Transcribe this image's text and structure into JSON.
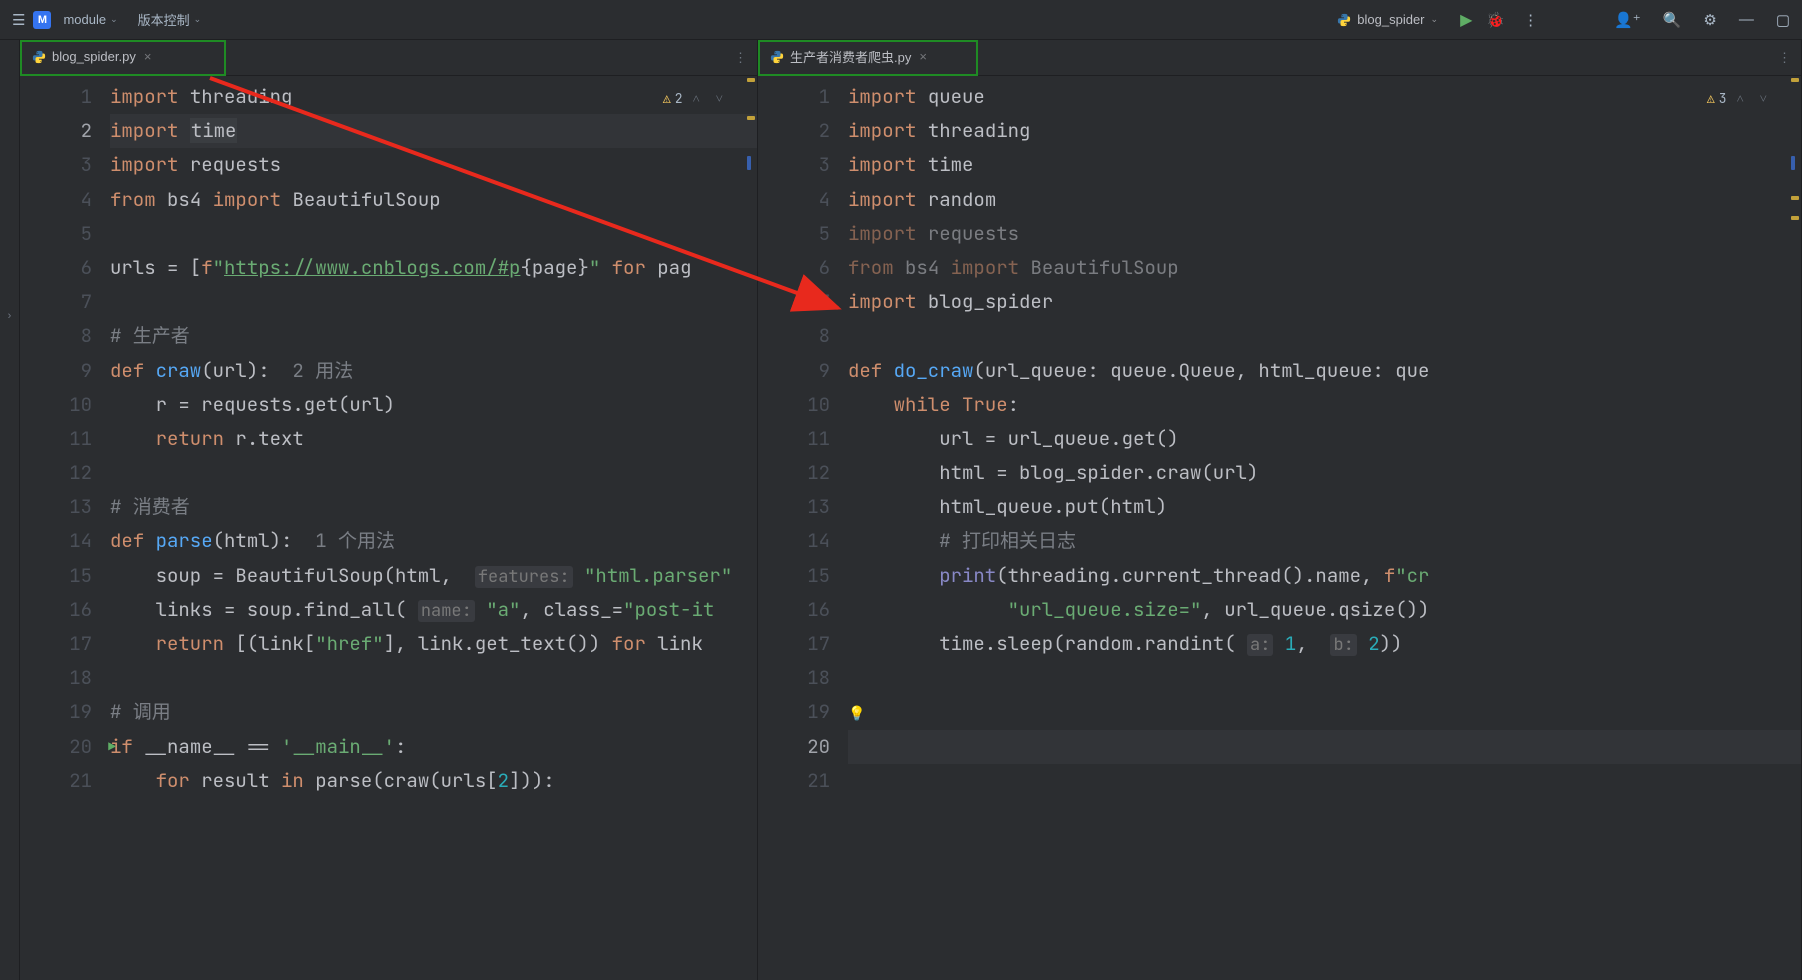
{
  "topbar": {
    "module_badge": "M",
    "module_label": "module",
    "vcs_label": "版本控制",
    "run_config": "blog_spider"
  },
  "left_editor": {
    "tab": "blog_spider.py",
    "warnings": "2",
    "lines": [
      {
        "n": "1",
        "html": "<span class='kw'>import</span> <span class='ident'>threading</span>"
      },
      {
        "n": "2",
        "html": "<span class='kw'>import</span> <span class='ident' style='background:#3a3d41;padding:0 1px'>time</span>",
        "cur": true,
        "hl": true
      },
      {
        "n": "3",
        "html": "<span class='kw'>import</span> <span class='ident'>requests</span>"
      },
      {
        "n": "4",
        "html": "<span class='kw'>from</span> <span class='ident'>bs4</span> <span class='kw'>import</span> <span class='ident'>BeautifulSoup</span>"
      },
      {
        "n": "5",
        "html": ""
      },
      {
        "n": "6",
        "html": "<span class='ident'>urls</span> = [<span class='kw'>f</span><span class='str'>\"<u>https://www.cnblogs.com/#p</u></span>{page}<span class='str'>\"</span> <span class='kw'>for</span> <span class='ident'>pag</span>"
      },
      {
        "n": "7",
        "html": ""
      },
      {
        "n": "8",
        "html": "<span class='cmt'># 生产者</span>"
      },
      {
        "n": "9",
        "html": "<span class='kw'>def</span> <span class='fn'>craw</span>(url):  <span class='cmt'>2 用法</span>"
      },
      {
        "n": "10",
        "html": "    r = requests.get(url)"
      },
      {
        "n": "11",
        "html": "    <span class='kw'>return</span> r.text"
      },
      {
        "n": "12",
        "html": ""
      },
      {
        "n": "13",
        "html": "<span class='cmt'># 消费者</span>"
      },
      {
        "n": "14",
        "html": "<span class='kw'>def</span> <span class='fn'>parse</span>(html):  <span class='cmt'>1 个用法</span>"
      },
      {
        "n": "15",
        "html": "    soup = BeautifulSoup(html,  <span class='hint'>features:</span> <span class='str'>\"html.parser\"</span>"
      },
      {
        "n": "16",
        "html": "    links = soup.find_all( <span class='hint'>name:</span> <span class='str'>\"a\"</span>, <span class='param'>class_</span>=<span class='str'>\"post-it</span>"
      },
      {
        "n": "17",
        "html": "    <span class='kw'>return</span> [(link[<span class='str'>\"href\"</span>], link.get_text()) <span class='kw'>for</span> link"
      },
      {
        "n": "18",
        "html": ""
      },
      {
        "n": "19",
        "html": "<span class='cmt'># 调用</span>"
      },
      {
        "n": "20",
        "html": "<span class='kw'>if</span> __name__ == <span class='str'>'__main__'</span>:",
        "run": true
      },
      {
        "n": "21",
        "html": "    <span class='kw'>for</span> result <span class='kw'>in</span> parse(craw(urls[<span class='num'>2</span>])):"
      }
    ]
  },
  "right_editor": {
    "tab": "生产者消费者爬虫.py",
    "warnings": "3",
    "lines": [
      {
        "n": "1",
        "html": "<span class='kw'>import</span> <span class='ident'>queue</span>"
      },
      {
        "n": "2",
        "html": "<span class='kw'>import</span> <span class='ident'>threading</span>"
      },
      {
        "n": "3",
        "html": "<span class='kw'>import</span> <span class='ident'>time</span>"
      },
      {
        "n": "4",
        "html": "<span class='kw'>import</span> <span class='ident'>random</span>"
      },
      {
        "n": "5",
        "html": "<span class='kw' style='opacity:.55'>import</span> <span class='ident' style='opacity:.55'>requests</span>"
      },
      {
        "n": "6",
        "html": "<span class='kw' style='opacity:.55'>from</span> <span class='ident' style='opacity:.55'>bs4</span> <span class='kw' style='opacity:.55'>import</span> <span class='ident' style='opacity:.55'>BeautifulSoup</span>"
      },
      {
        "n": "7",
        "html": "<span class='kw'>import</span> <span class='ident'>blog_spider</span>"
      },
      {
        "n": "8",
        "html": ""
      },
      {
        "n": "9",
        "html": "<span class='kw'>def</span> <span class='fn'>do_craw</span>(url_queue: queue.Queue, html_queue: que"
      },
      {
        "n": "10",
        "html": "    <span class='kw'>while</span> <span class='kw'>True</span>:"
      },
      {
        "n": "11",
        "html": "        url = url_queue.get()"
      },
      {
        "n": "12",
        "html": "        html = blog_spider.craw(url)"
      },
      {
        "n": "13",
        "html": "        html_queue.put(html)"
      },
      {
        "n": "14",
        "html": "        <span class='cmt'># 打印相关日志</span>"
      },
      {
        "n": "15",
        "html": "        <span class='builtin'>print</span>(threading.current_thread().name, <span class='kw'>f</span><span class='str'>\"cr</span>"
      },
      {
        "n": "16",
        "html": "              <span class='str'>\"url_queue.size=\"</span>, url_queue.qsize())"
      },
      {
        "n": "17",
        "html": "        time.sleep(random.randint( <span class='hint'>a:</span> <span class='num'>1</span>,  <span class='hint'>b:</span> <span class='num'>2</span>))"
      },
      {
        "n": "18",
        "html": ""
      },
      {
        "n": "19",
        "html": "",
        "bulb": true
      },
      {
        "n": "20",
        "html": "",
        "cur": true,
        "hl": true
      },
      {
        "n": "21",
        "html": ""
      }
    ]
  }
}
